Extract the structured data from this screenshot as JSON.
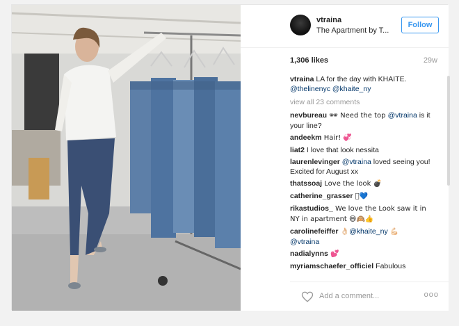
{
  "post": {
    "username": "vtraina",
    "location": "The Apartment by T...",
    "follow_label": "Follow",
    "likes": "1,306 likes",
    "age": "29w"
  },
  "caption": {
    "user": "vtraina",
    "text_1": " LA for the day with KHAITE. ",
    "mention_1": "@thelinenyc",
    "space": " ",
    "mention_2": "@khaite_ny"
  },
  "view_all": "view all 23 comments",
  "comments": [
    {
      "user": "nevbureau",
      "pre": " 🕶 Need the top ",
      "mention": "@vtraina",
      "post": " is it your line?"
    },
    {
      "user": "andeekm",
      "text": " Hair! 💞"
    },
    {
      "user": "liat2",
      "text": " I love that look nessita"
    },
    {
      "user": "laurenlevinger",
      "mention": " @vtraina",
      "post": " loved seeing you! Excited for August xx"
    },
    {
      "user": "thatssoaj",
      "text": " Love the look 💣"
    },
    {
      "user": "catherine_grasser",
      "text": " 🏻💙"
    },
    {
      "user": "rikastudios_",
      "text": " We love the Look saw it in NY in apartment 😄🙉👍"
    },
    {
      "user": "carolinefeiffer",
      "pre": " 👌🏻",
      "mention": "@khaite_ny",
      "post": " 💪🏻",
      "mention_2": "@vtraina"
    },
    {
      "user": "nadialynns",
      "text": " 💕"
    },
    {
      "user": "myriamschaefer_officiel",
      "text": " Fabulous"
    }
  ],
  "add_comment": {
    "placeholder": "Add a comment...",
    "more": "ooo"
  },
  "colors": {
    "accent": "#3897f0",
    "mention": "#003569",
    "muted": "#999999",
    "text": "#262626"
  },
  "icons": {
    "heart": "heart-icon",
    "more": "more-options-icon"
  }
}
